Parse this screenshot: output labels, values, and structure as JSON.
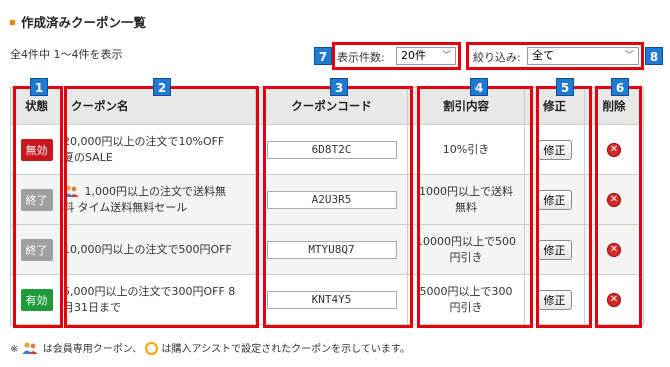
{
  "page": {
    "title": "作成済みクーポン一覧",
    "count_text": "全4件中 1～4件を表示"
  },
  "controls": {
    "per_page_label": "表示件数:",
    "per_page_value": "20件",
    "filter_label": "絞り込み:",
    "filter_value": "全て"
  },
  "badges": [
    "1",
    "2",
    "3",
    "4",
    "5",
    "6",
    "7",
    "8"
  ],
  "table": {
    "headers": {
      "status": "状態",
      "name": "クーポン名",
      "code": "クーポンコード",
      "discount": "割引内容",
      "edit": "修正",
      "delete": "削除"
    },
    "rows": [
      {
        "status": "無効",
        "status_color": "#c8161d",
        "name_line1": "20,000円以上の注文で10%OFF",
        "name_line2": "夏のSALE",
        "member_icon": false,
        "code": "6D8T2C",
        "discount_line1": "10%引き",
        "discount_line2": "",
        "edit_label": "修正"
      },
      {
        "status": "終了",
        "status_color": "#a0a0a0",
        "name_line1": " 1,000円以上の注文で送料無",
        "name_line2": "料 タイム送料無料セール",
        "member_icon": true,
        "code": "A2U3R5",
        "discount_line1": "1000円以上で送料",
        "discount_line2": "無料",
        "edit_label": "修正"
      },
      {
        "status": "終了",
        "status_color": "#a0a0a0",
        "name_line1": "10,000円以上の注文で500円OFF",
        "name_line2": "",
        "member_icon": false,
        "code": "MTYU8Q7",
        "discount_line1": "10000円以上で500",
        "discount_line2": "円引き",
        "edit_label": "修正"
      },
      {
        "status": "有効",
        "status_color": "#1f9a3a",
        "name_line1": "5,000円以上の注文で300円OFF 8",
        "name_line2": "月31日まで",
        "member_icon": false,
        "code": "KNT4Y5",
        "discount_line1": "5000円以上で300",
        "discount_line2": "円引き",
        "edit_label": "修正"
      }
    ]
  },
  "footnote": {
    "prefix": "※",
    "member_text": "は会員専用クーポン、",
    "assist_text": "は購入アシストで設定されたクーポンを示しています。"
  },
  "colors": {
    "accent_orange": "#f08300",
    "highlight_red": "#e00010",
    "badge_blue": "#1e7ad2"
  }
}
